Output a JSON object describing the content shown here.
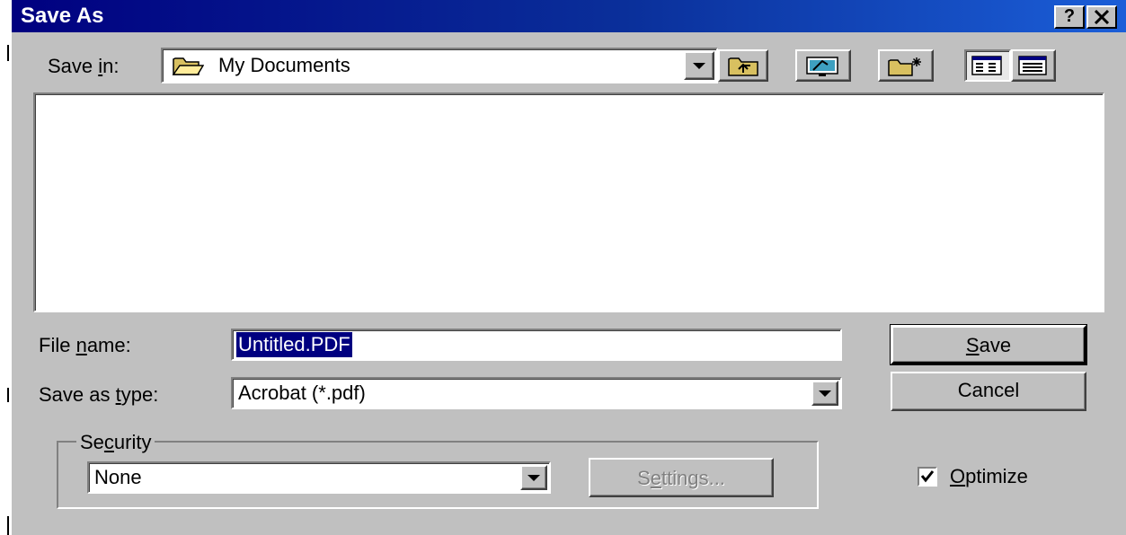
{
  "dialog": {
    "title": "Save As",
    "help_button": "?",
    "close_button": "✕"
  },
  "toolbar": {
    "save_in_label": "Save in:",
    "location": "My Documents",
    "location_icon": "folder-open-icon",
    "buttons": [
      {
        "name": "up-one-level",
        "icon": "up-folder-icon"
      },
      {
        "name": "desktop",
        "icon": "desktop-icon"
      },
      {
        "name": "create-new-folder",
        "icon": "new-folder-icon"
      },
      {
        "name": "list-view",
        "icon": "list-view-icon"
      },
      {
        "name": "details-view",
        "icon": "details-view-icon"
      }
    ]
  },
  "form": {
    "file_name_label": "File name:",
    "file_name_value": "Untitled.PDF",
    "save_as_type_label": "Save as type:",
    "save_as_type_value": "Acrobat (*.pdf)"
  },
  "buttons": {
    "save": "Save",
    "cancel": "Cancel"
  },
  "security": {
    "legend": "Security",
    "value": "None",
    "settings_label": "Settings..."
  },
  "optimize": {
    "label": "Optimize",
    "checked": true
  },
  "colors": {
    "title_bar": "#000080",
    "face": "#c0c0c0",
    "selection": "#000080"
  }
}
